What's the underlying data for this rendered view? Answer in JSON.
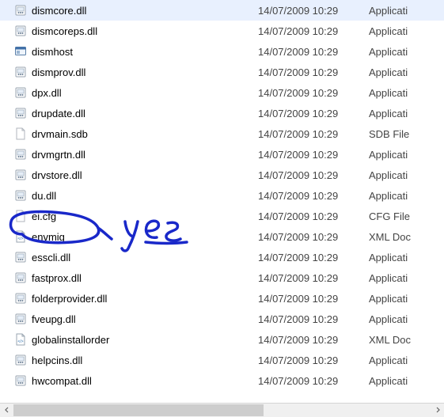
{
  "files": [
    {
      "name": "dismcore.dll",
      "date": "14/07/2009 10:29",
      "type": "Applicati",
      "icon": "dll"
    },
    {
      "name": "dismcoreps.dll",
      "date": "14/07/2009 10:29",
      "type": "Applicati",
      "icon": "dll"
    },
    {
      "name": "dismhost",
      "date": "14/07/2009 10:29",
      "type": "Applicati",
      "icon": "exe"
    },
    {
      "name": "dismprov.dll",
      "date": "14/07/2009 10:29",
      "type": "Applicati",
      "icon": "dll"
    },
    {
      "name": "dpx.dll",
      "date": "14/07/2009 10:29",
      "type": "Applicati",
      "icon": "dll"
    },
    {
      "name": "drupdate.dll",
      "date": "14/07/2009 10:29",
      "type": "Applicati",
      "icon": "dll"
    },
    {
      "name": "drvmain.sdb",
      "date": "14/07/2009 10:29",
      "type": "SDB File",
      "icon": "file"
    },
    {
      "name": "drvmgrtn.dll",
      "date": "14/07/2009 10:29",
      "type": "Applicati",
      "icon": "dll"
    },
    {
      "name": "drvstore.dll",
      "date": "14/07/2009 10:29",
      "type": "Applicati",
      "icon": "dll"
    },
    {
      "name": "du.dll",
      "date": "14/07/2009 10:29",
      "type": "Applicati",
      "icon": "dll"
    },
    {
      "name": "ei.cfg",
      "date": "14/07/2009 10:29",
      "type": "CFG File",
      "icon": "file"
    },
    {
      "name": "envmig",
      "date": "14/07/2009 10:29",
      "type": "XML Doc",
      "icon": "xml"
    },
    {
      "name": "esscli.dll",
      "date": "14/07/2009 10:29",
      "type": "Applicati",
      "icon": "dll"
    },
    {
      "name": "fastprox.dll",
      "date": "14/07/2009 10:29",
      "type": "Applicati",
      "icon": "dll"
    },
    {
      "name": "folderprovider.dll",
      "date": "14/07/2009 10:29",
      "type": "Applicati",
      "icon": "dll"
    },
    {
      "name": "fveupg.dll",
      "date": "14/07/2009 10:29",
      "type": "Applicati",
      "icon": "dll"
    },
    {
      "name": "globalinstallorder",
      "date": "14/07/2009 10:29",
      "type": "XML Doc",
      "icon": "xml"
    },
    {
      "name": "helpcins.dll",
      "date": "14/07/2009 10:29",
      "type": "Applicati",
      "icon": "dll"
    },
    {
      "name": "hwcompat.dll",
      "date": "14/07/2009 10:29",
      "type": "Applicati",
      "icon": "dll"
    }
  ],
  "annotation_text": "yes"
}
